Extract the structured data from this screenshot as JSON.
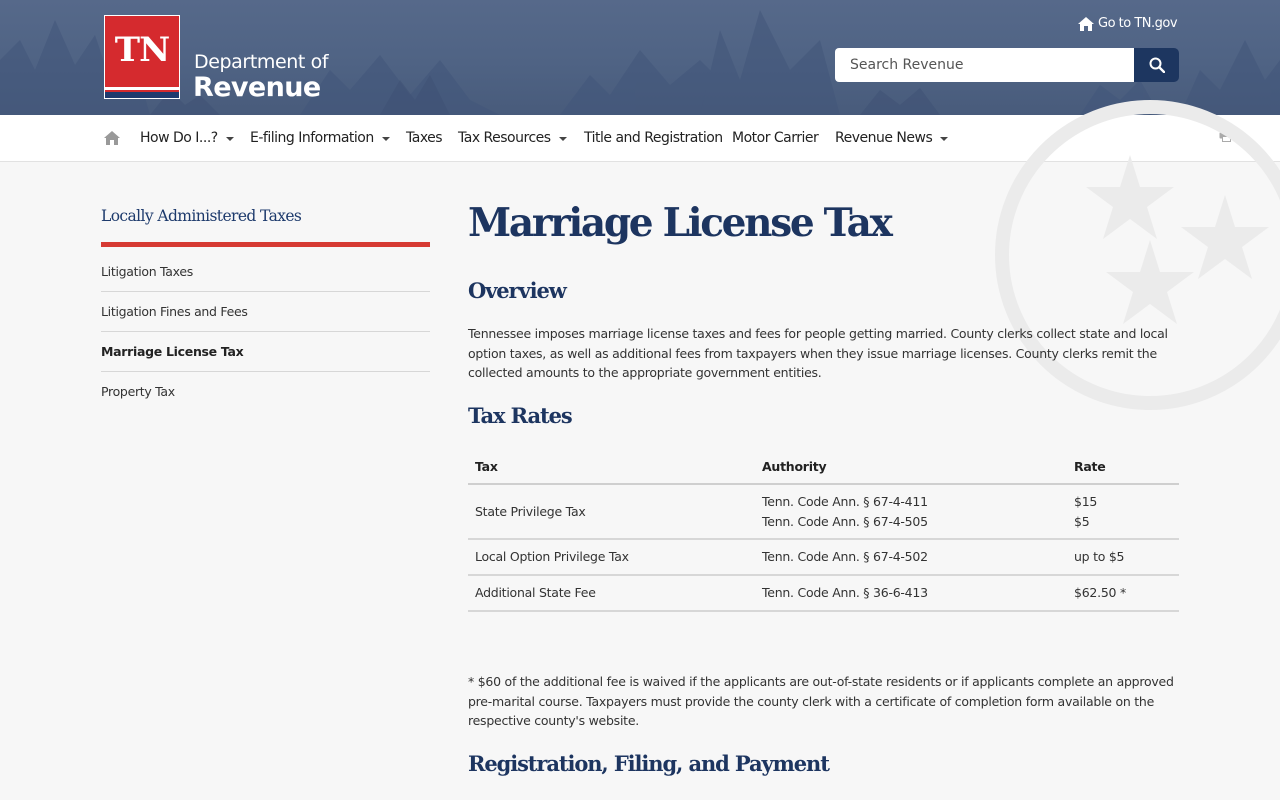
{
  "header": {
    "logo_text": "TN",
    "dept_line1": "Department of",
    "dept_line2": "Revenue",
    "goto_link": "Go to TN.gov",
    "search_placeholder": "Search Revenue"
  },
  "nav": {
    "items": [
      {
        "label": "How Do I...?",
        "dropdown": true
      },
      {
        "label": "E-filing Information",
        "dropdown": true
      },
      {
        "label": "Taxes",
        "dropdown": false
      },
      {
        "label": "Tax Resources",
        "dropdown": true
      },
      {
        "label": "Title and Registration",
        "dropdown": false
      },
      {
        "label": "Motor Carrier",
        "dropdown": false
      },
      {
        "label": "Revenue News",
        "dropdown": true
      }
    ]
  },
  "sidebar": {
    "title": "Locally Administered Taxes",
    "items": [
      {
        "label": "Litigation Taxes"
      },
      {
        "label": "Litigation Fines and Fees"
      },
      {
        "label": "Marriage License Tax",
        "active": true
      },
      {
        "label": "Property Tax"
      }
    ]
  },
  "main": {
    "title": "Marriage License Tax",
    "overview_heading": "Overview",
    "overview_text": "Tennessee imposes marriage license taxes and fees for people getting married.  County clerks collect state and local option taxes, as well as additional fees from taxpayers when they issue marriage licenses.  County clerks remit the collected amounts to the appropriate government entities.",
    "rates_heading": "Tax Rates",
    "table": {
      "headers": [
        "Tax",
        "Authority",
        "Rate"
      ],
      "rows": [
        {
          "tax": "State Privilege Tax",
          "authority": [
            "Tenn. Code Ann. § 67-4-411",
            "Tenn. Code Ann. §  67-4-505"
          ],
          "rate": [
            "$15",
            "$5"
          ]
        },
        {
          "tax": "Local Option Privilege Tax",
          "authority": [
            "Tenn. Code Ann. § 67-4-502"
          ],
          "rate": [
            "up to $5"
          ]
        },
        {
          "tax": "Additional State Fee",
          "authority": [
            "Tenn. Code Ann. § 36-6-413"
          ],
          "rate": [
            "$62.50 *"
          ]
        }
      ]
    },
    "footnote": "* $60 of the additional fee is waived if the applicants are out-of-state residents or if applicants complete an approved pre-marital course.  Taxpayers must provide the county clerk with a certificate of completion form available on the respective county's website.",
    "registration_heading": "Registration, Filing, and Payment"
  },
  "colors": {
    "header_bg": "#4f6384",
    "logo_red": "#d52a2e",
    "navy": "#1d3560",
    "accent_red": "#d63a33"
  }
}
